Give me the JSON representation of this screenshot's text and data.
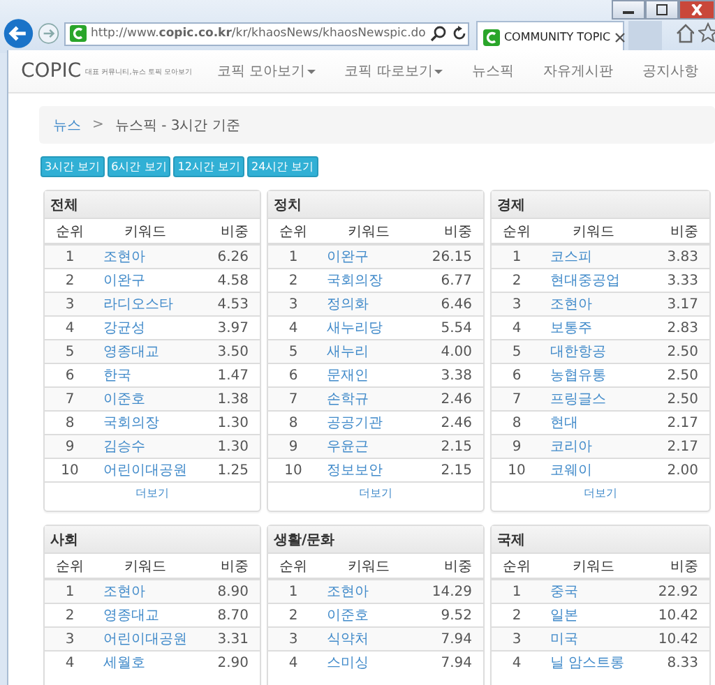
{
  "browser": {
    "url": "http://www.**copic.co.kr**/kr/khaosNews/khaosNewspic.do",
    "tab_title": "COMMUNITY TOPIC"
  },
  "site": {
    "logo": "COPIC",
    "tagline": "대표 커뮤니티,뉴스 토픽 모아보기",
    "nav": [
      {
        "label": "코픽 모아보기",
        "dropdown": true
      },
      {
        "label": "코픽 따로보기",
        "dropdown": true
      },
      {
        "label": "뉴스픽",
        "dropdown": false
      },
      {
        "label": "자유게시판",
        "dropdown": false
      },
      {
        "label": "공지사항",
        "dropdown": false
      }
    ]
  },
  "breadcrumb": {
    "link": "뉴스",
    "separator": ">",
    "current": "뉴스픽 - 3시간 기준"
  },
  "time_buttons": [
    "3시간 보기",
    "6시간 보기",
    "12시간 보기",
    "24시간 보기"
  ],
  "panels": [
    {
      "title": "전체",
      "columns": [
        "순위",
        "키워드",
        "비중"
      ],
      "more": "더보기",
      "rows": [
        {
          "rank": "1",
          "keyword": "조현아",
          "ratio": "6.26"
        },
        {
          "rank": "2",
          "keyword": "이완구",
          "ratio": "4.58"
        },
        {
          "rank": "3",
          "keyword": "라디오스타",
          "ratio": "4.53"
        },
        {
          "rank": "4",
          "keyword": "강균성",
          "ratio": "3.97"
        },
        {
          "rank": "5",
          "keyword": "영종대교",
          "ratio": "3.50"
        },
        {
          "rank": "6",
          "keyword": "한국",
          "ratio": "1.47"
        },
        {
          "rank": "7",
          "keyword": "이준호",
          "ratio": "1.38"
        },
        {
          "rank": "8",
          "keyword": "국회의장",
          "ratio": "1.30"
        },
        {
          "rank": "9",
          "keyword": "김승수",
          "ratio": "1.30"
        },
        {
          "rank": "10",
          "keyword": "어린이대공원",
          "ratio": "1.25"
        }
      ]
    },
    {
      "title": "정치",
      "columns": [
        "순위",
        "키워드",
        "비중"
      ],
      "more": "더보기",
      "rows": [
        {
          "rank": "1",
          "keyword": "이완구",
          "ratio": "26.15"
        },
        {
          "rank": "2",
          "keyword": "국회의장",
          "ratio": "6.77"
        },
        {
          "rank": "3",
          "keyword": "정의화",
          "ratio": "6.46"
        },
        {
          "rank": "4",
          "keyword": "새누리당",
          "ratio": "5.54"
        },
        {
          "rank": "5",
          "keyword": "새누리",
          "ratio": "4.00"
        },
        {
          "rank": "6",
          "keyword": "문재인",
          "ratio": "3.38"
        },
        {
          "rank": "7",
          "keyword": "손학규",
          "ratio": "2.46"
        },
        {
          "rank": "8",
          "keyword": "공공기관",
          "ratio": "2.46"
        },
        {
          "rank": "9",
          "keyword": "우윤근",
          "ratio": "2.15"
        },
        {
          "rank": "10",
          "keyword": "정보보안",
          "ratio": "2.15"
        }
      ]
    },
    {
      "title": "경제",
      "columns": [
        "순위",
        "키워드",
        "비중"
      ],
      "more": "더보기",
      "rows": [
        {
          "rank": "1",
          "keyword": "코스피",
          "ratio": "3.83"
        },
        {
          "rank": "2",
          "keyword": "현대중공업",
          "ratio": "3.33"
        },
        {
          "rank": "3",
          "keyword": "조현아",
          "ratio": "3.17"
        },
        {
          "rank": "4",
          "keyword": "보통주",
          "ratio": "2.83"
        },
        {
          "rank": "5",
          "keyword": "대한항공",
          "ratio": "2.50"
        },
        {
          "rank": "6",
          "keyword": "농협유통",
          "ratio": "2.50"
        },
        {
          "rank": "7",
          "keyword": "프링글스",
          "ratio": "2.50"
        },
        {
          "rank": "8",
          "keyword": "현대",
          "ratio": "2.17"
        },
        {
          "rank": "9",
          "keyword": "코리아",
          "ratio": "2.17"
        },
        {
          "rank": "10",
          "keyword": "코웨이",
          "ratio": "2.00"
        }
      ]
    },
    {
      "title": "사회",
      "columns": [
        "순위",
        "키워드",
        "비중"
      ],
      "rows": [
        {
          "rank": "1",
          "keyword": "조현아",
          "ratio": "8.90"
        },
        {
          "rank": "2",
          "keyword": "영종대교",
          "ratio": "8.70"
        },
        {
          "rank": "3",
          "keyword": "어린이대공원",
          "ratio": "3.31"
        },
        {
          "rank": "4",
          "keyword": "세월호",
          "ratio": "2.90"
        }
      ]
    },
    {
      "title": "생활/문화",
      "columns": [
        "순위",
        "키워드",
        "비중"
      ],
      "rows": [
        {
          "rank": "1",
          "keyword": "조현아",
          "ratio": "14.29"
        },
        {
          "rank": "2",
          "keyword": "이준호",
          "ratio": "9.52"
        },
        {
          "rank": "3",
          "keyword": "식약처",
          "ratio": "7.94"
        },
        {
          "rank": "4",
          "keyword": "스미싱",
          "ratio": "7.94"
        }
      ]
    },
    {
      "title": "국제",
      "columns": [
        "순위",
        "키워드",
        "비중"
      ],
      "rows": [
        {
          "rank": "1",
          "keyword": "중국",
          "ratio": "22.92"
        },
        {
          "rank": "2",
          "keyword": "일본",
          "ratio": "10.42"
        },
        {
          "rank": "3",
          "keyword": "미국",
          "ratio": "10.42"
        },
        {
          "rank": "4",
          "keyword": "닐 암스트롱",
          "ratio": "8.33"
        }
      ]
    }
  ]
}
